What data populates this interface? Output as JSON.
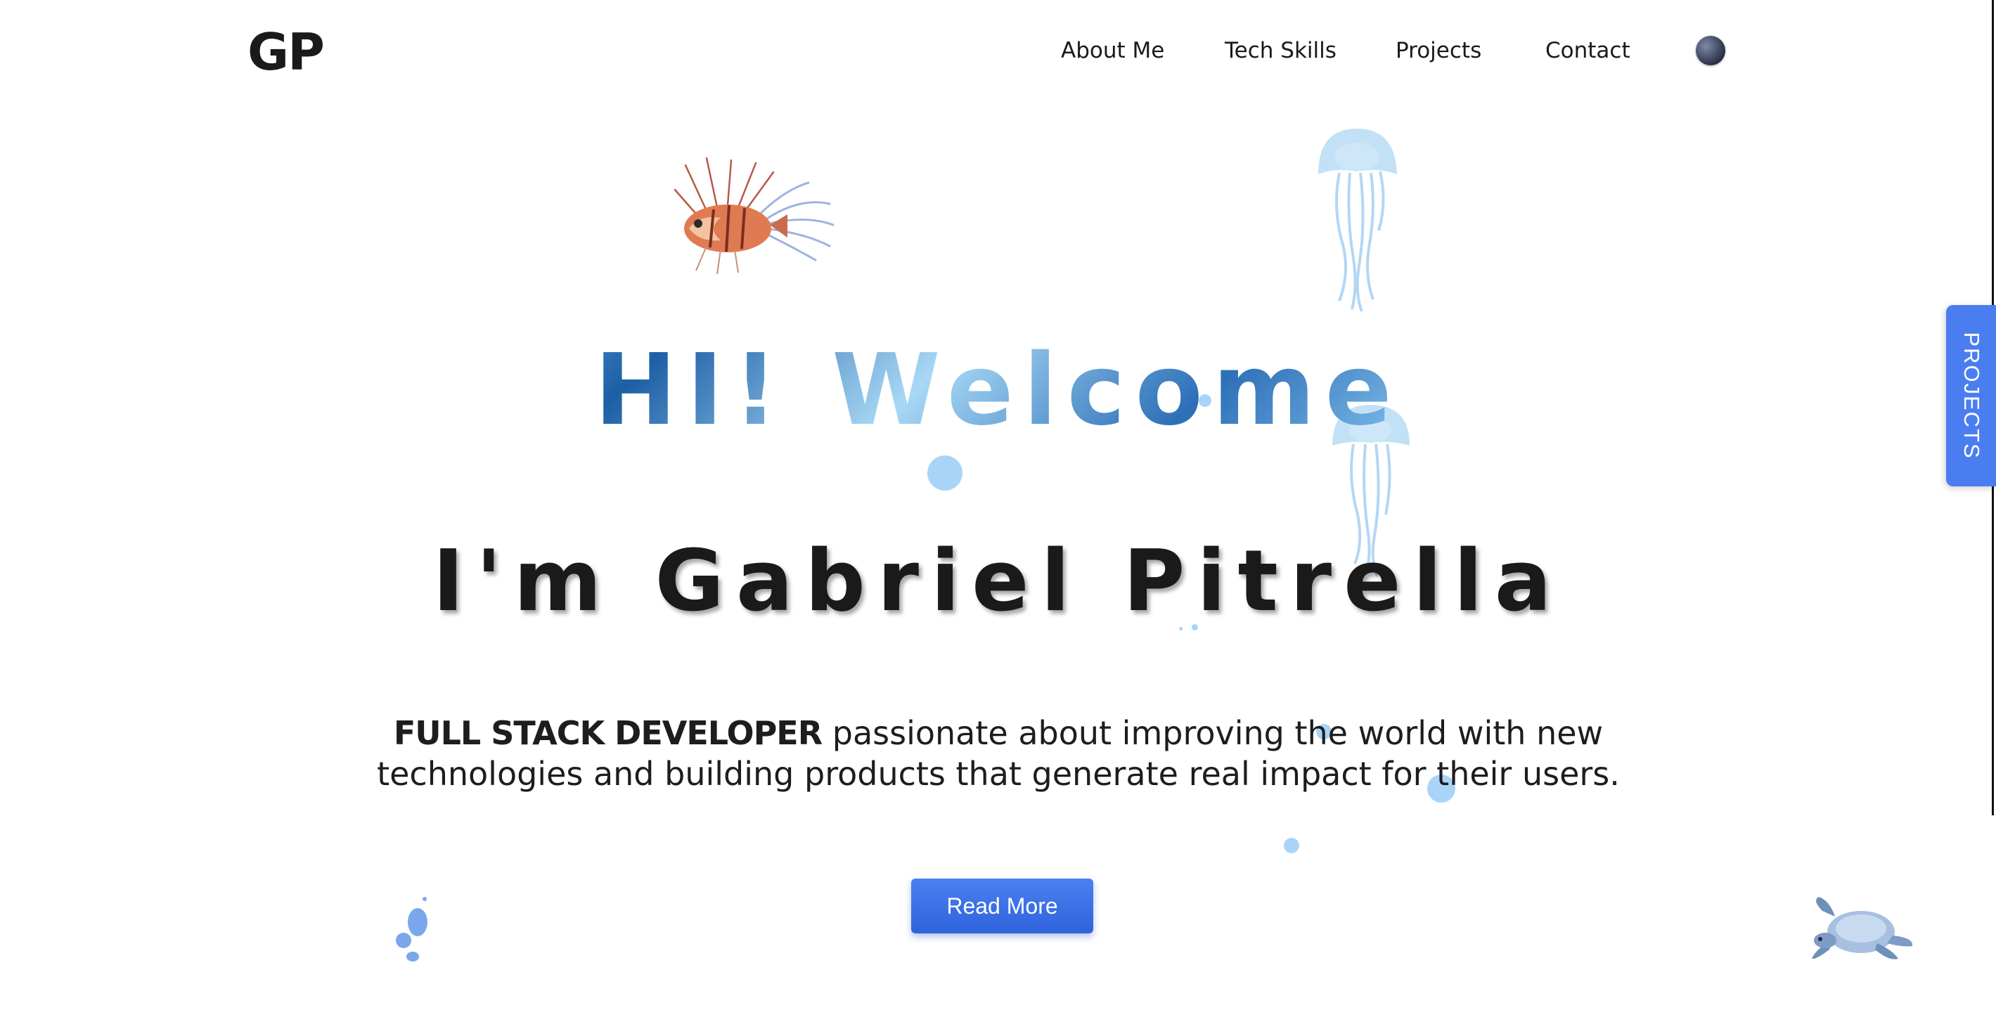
{
  "nav": {
    "logo": "GP",
    "links": [
      "About Me",
      "Tech Skills",
      "Projects",
      "Contact"
    ],
    "theme_icon": "moon-icon"
  },
  "side_tab": {
    "label": "PROJECTS"
  },
  "hero": {
    "greeting": "HI! Welcome",
    "name": "I'm Gabriel Pitrella",
    "role": "FULL STACK DEVELOPER",
    "description": " passionate about improving the world with new technologies and building products that generate real impact for their users.",
    "button_label": "Read More"
  },
  "decorations": [
    "lionfish-icon",
    "jellyfish-icon",
    "sea-turtle-icon"
  ],
  "colors": {
    "accent": "#4a7ef0",
    "water": "#a9d4f7",
    "text": "#1d1d1f"
  }
}
